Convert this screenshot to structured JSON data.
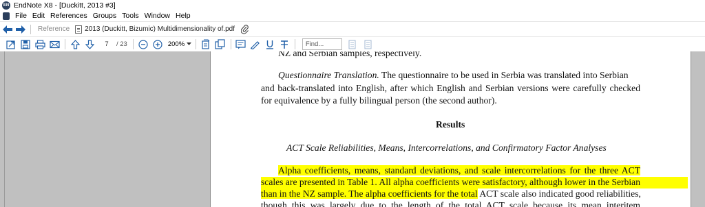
{
  "window": {
    "title": "EndNote X8 - [Duckitt, 2013 #3]"
  },
  "menu": [
    "File",
    "Edit",
    "References",
    "Groups",
    "Tools",
    "Window",
    "Help"
  ],
  "nav": {
    "reference_label": "Reference",
    "pdf_tab_label": "2013 (Duckitt, Bizumic) Multidimensionality of.pdf"
  },
  "toolbar": {
    "page_number": "7",
    "page_total": "/ 23",
    "zoom": "200%",
    "find_placeholder": "Find..."
  },
  "document": {
    "line_top": "NZ and Serbian samples, respectively.",
    "para1_heading": "Questionnaire Translation.",
    "para1_line1_rest": " The questionnaire to be used in Serbia was translated into Serbian",
    "para1_line2": "and back-translated into English, after which English and Serbian versions were carefully checked",
    "para1_line3": "for equivalence by a fully bilingual person (the second author).",
    "results_heading": "Results",
    "subheading": "ACT Scale Reliabilities, Means, Intercorrelations, and Confirmatory Factor Analyses",
    "para2_line1": "Alpha coefficients, means, standard deviations, and scale intercorrelations for the three ACT",
    "para2_line2": "scales are presented in Table 1. All alpha coefficients were satisfactory, although lower in the Serbian",
    "para2_line3_hl": "than in the NZ sample. The alpha coefficients for the total",
    "para2_line3_rest": " ACT scale also indicated good reliabilities,",
    "para2_line4": "though this was largely due to the length of the total ACT scale because its mean interitem"
  },
  "colors": {
    "highlight": "#ffff00",
    "viewer_bg": "#c0c0c0",
    "icon_blue": "#1f5fa8"
  }
}
